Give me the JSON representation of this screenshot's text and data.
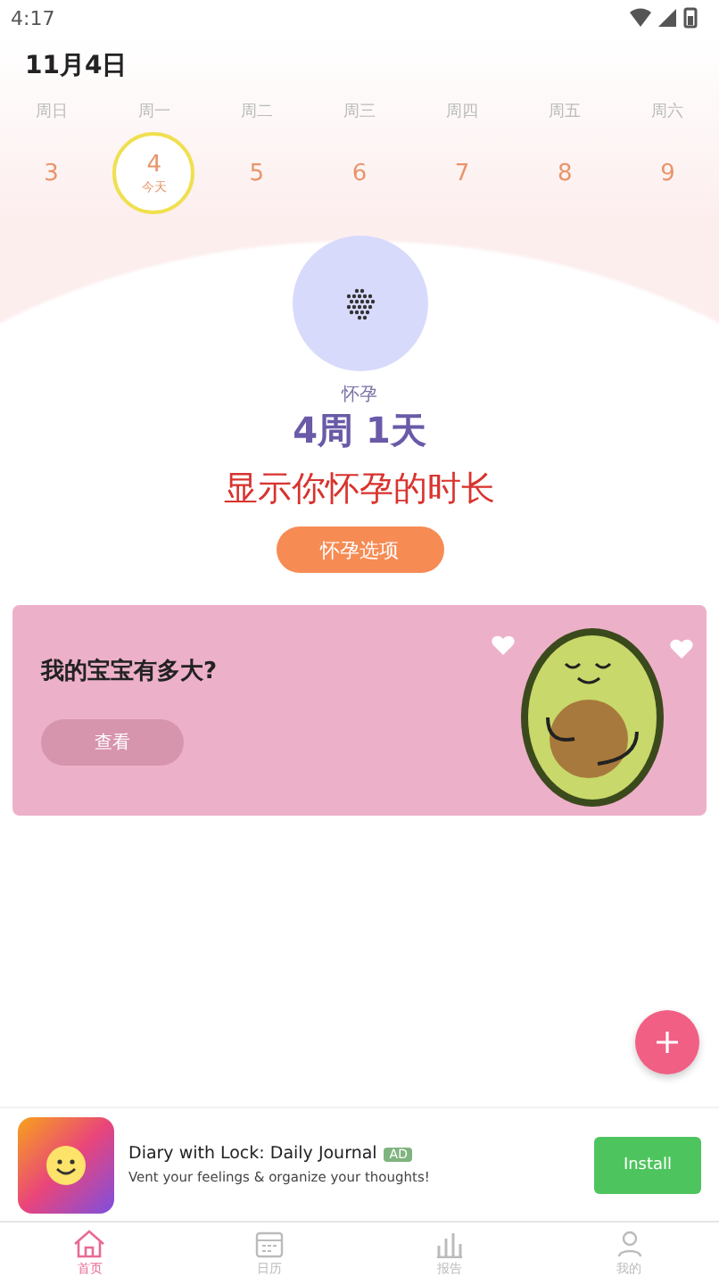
{
  "status_bar": {
    "time": "4:17"
  },
  "date_title": "11月4日",
  "week": [
    {
      "weekday": "周日",
      "day": "3",
      "selected": false
    },
    {
      "weekday": "周一",
      "day": "4",
      "today_label": "今天",
      "selected": true
    },
    {
      "weekday": "周二",
      "day": "5",
      "selected": false
    },
    {
      "weekday": "周三",
      "day": "6",
      "selected": false
    },
    {
      "weekday": "周四",
      "day": "7",
      "selected": false
    },
    {
      "weekday": "周五",
      "day": "8",
      "selected": false
    },
    {
      "weekday": "周六",
      "day": "9",
      "selected": false
    }
  ],
  "pregnancy": {
    "label": "怀孕",
    "duration": "4周 1天",
    "headline": "显示你怀孕的时长",
    "button": "怀孕选项"
  },
  "baby_card": {
    "title": "我的宝宝有多大?",
    "button": "查看"
  },
  "ad": {
    "title": "Diary with Lock: Daily Journal",
    "badge": "AD",
    "description": "Vent your feelings & organize your thoughts!",
    "button": "Install"
  },
  "nav": [
    {
      "label": "首页",
      "kind": "home",
      "selected": true
    },
    {
      "label": "日历",
      "kind": "calendar",
      "selected": false
    },
    {
      "label": "报告",
      "kind": "report",
      "selected": false
    },
    {
      "label": "我的",
      "kind": "profile",
      "selected": false
    }
  ]
}
